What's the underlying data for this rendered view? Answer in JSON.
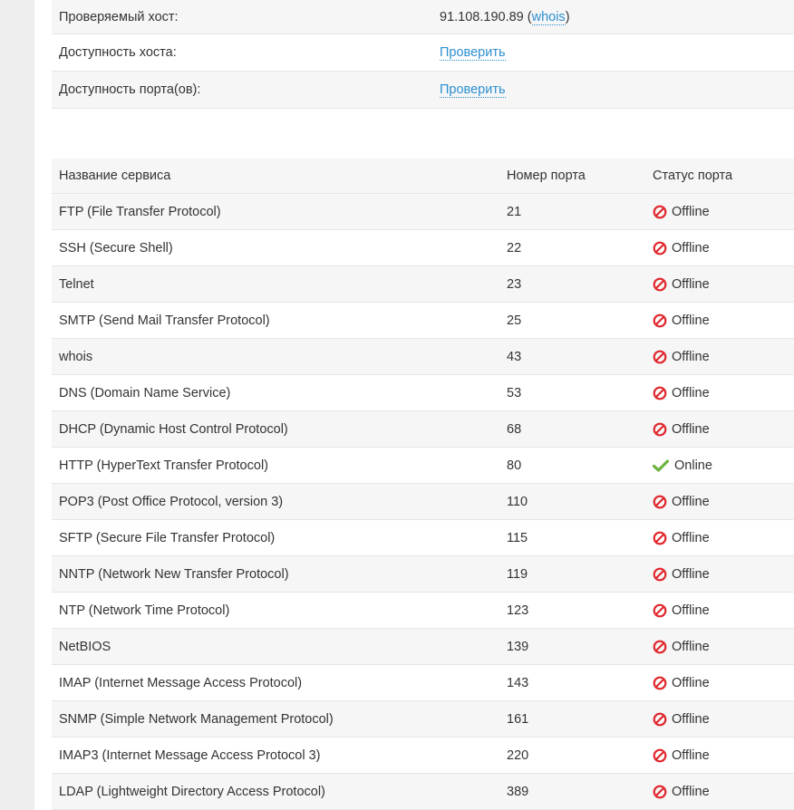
{
  "host_info": {
    "host_label": "Проверяемый хост:",
    "host_ip": "91.108.190.89",
    "whois_link": "whois",
    "host_availability_label": "Доступность хоста:",
    "host_availability_action": "Проверить",
    "port_availability_label": "Доступность порта(ов):",
    "port_availability_action": "Проверить"
  },
  "ports_table": {
    "headers": {
      "service": "Название сервиса",
      "port": "Номер порта",
      "status": "Статус порта"
    },
    "rows": [
      {
        "service": "FTP (File Transfer Protocol)",
        "port": "21",
        "status": "Offline",
        "icon": "offline-icon"
      },
      {
        "service": "SSH (Secure Shell)",
        "port": "22",
        "status": "Offline",
        "icon": "offline-icon"
      },
      {
        "service": "Telnet",
        "port": "23",
        "status": "Offline",
        "icon": "offline-icon"
      },
      {
        "service": "SMTP (Send Mail Transfer Protocol)",
        "port": "25",
        "status": "Offline",
        "icon": "offline-icon"
      },
      {
        "service": "whois",
        "port": "43",
        "status": "Offline",
        "icon": "offline-icon"
      },
      {
        "service": "DNS (Domain Name Service)",
        "port": "53",
        "status": "Offline",
        "icon": "offline-icon"
      },
      {
        "service": "DHCP (Dynamic Host Control Protocol)",
        "port": "68",
        "status": "Offline",
        "icon": "offline-icon"
      },
      {
        "service": "HTTP (HyperText Transfer Protocol)",
        "port": "80",
        "status": "Online",
        "icon": "online-icon"
      },
      {
        "service": "POP3 (Post Office Protocol, version 3)",
        "port": "110",
        "status": "Offline",
        "icon": "offline-icon"
      },
      {
        "service": "SFTP (Secure File Transfer Protocol)",
        "port": "115",
        "status": "Offline",
        "icon": "offline-icon"
      },
      {
        "service": "NNTP (Network New Transfer Protocol)",
        "port": "119",
        "status": "Offline",
        "icon": "offline-icon"
      },
      {
        "service": "NTP (Network Time Protocol)",
        "port": "123",
        "status": "Offline",
        "icon": "offline-icon"
      },
      {
        "service": "NetBIOS",
        "port": "139",
        "status": "Offline",
        "icon": "offline-icon"
      },
      {
        "service": "IMAP (Internet Message Access Protocol)",
        "port": "143",
        "status": "Offline",
        "icon": "offline-icon"
      },
      {
        "service": "SNMP (Simple Network Management Protocol)",
        "port": "161",
        "status": "Offline",
        "icon": "offline-icon"
      },
      {
        "service": "IMAP3 (Internet Message Access Protocol 3)",
        "port": "220",
        "status": "Offline",
        "icon": "offline-icon"
      },
      {
        "service": "LDAP (Lightweight Directory Access Protocol)",
        "port": "389",
        "status": "Offline",
        "icon": "offline-icon"
      }
    ]
  },
  "colors": {
    "link": "#2b8fd1",
    "offline": "#e0282e",
    "online": "#6db33f",
    "row_shade": "#f6f6f6",
    "border": "#e6e6e6"
  }
}
